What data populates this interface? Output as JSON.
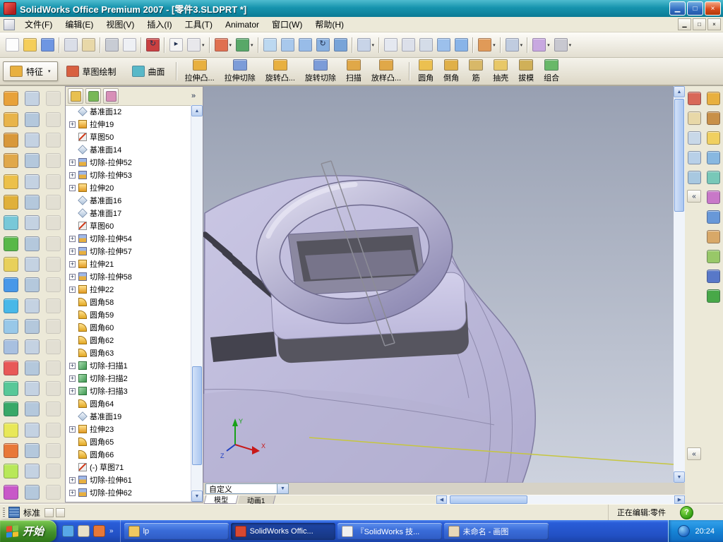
{
  "window": {
    "title": "SolidWorks Office Premium 2007 - [零件3.SLDPRT *]"
  },
  "icons": {
    "dropdown": "▾",
    "chevron_double_left": "«",
    "chevron_double_right": "»",
    "up": "▲",
    "down": "▼",
    "left": "◀",
    "right": "▶",
    "minimize": "▁",
    "maximize": "□",
    "close": "×",
    "plus": "+"
  },
  "menu": {
    "items": [
      {
        "label": "文件(F)",
        "name": "menu-file"
      },
      {
        "label": "编辑(E)",
        "name": "menu-edit"
      },
      {
        "label": "视图(V)",
        "name": "menu-view"
      },
      {
        "label": "插入(I)",
        "name": "menu-insert"
      },
      {
        "label": "工具(T)",
        "name": "menu-tools"
      },
      {
        "label": "Animator",
        "name": "menu-animator"
      },
      {
        "label": "窗口(W)",
        "name": "menu-window"
      },
      {
        "label": "帮助(H)",
        "name": "menu-help"
      }
    ]
  },
  "main_toolbar": {
    "buttons": [
      {
        "name": "new-button",
        "color": "#FDFDFD"
      },
      {
        "name": "open-button",
        "color": "#F5CE5A"
      },
      {
        "name": "save-button",
        "color": "#6E96E2"
      },
      {
        "sep": true
      },
      {
        "name": "make-drawing-button",
        "color": "#DADEE8"
      },
      {
        "name": "make-assembly-button",
        "color": "#E8D8A8"
      },
      {
        "sep": true
      },
      {
        "name": "print-button",
        "color": "#C8CCD4"
      },
      {
        "name": "print-preview-button",
        "color": "#EEF0F4"
      },
      {
        "sep": true
      },
      {
        "name": "rebuild-button",
        "color": "#C94040",
        "glyph": "↻"
      },
      {
        "sep": true
      },
      {
        "name": "select-button",
        "color": "#F4F4F4",
        "glyph": "▸"
      },
      {
        "name": "selection-filter-button",
        "color": "#E8E8EC",
        "dd": true
      },
      {
        "sep": true
      },
      {
        "name": "sketch-button",
        "color": "#E07050",
        "dd": true
      },
      {
        "name": "smart-dimension-button",
        "color": "#58A868",
        "dd": true
      },
      {
        "sep": true
      },
      {
        "name": "zoom-fit-button",
        "color": "#BCD8F0"
      },
      {
        "name": "zoom-area-button",
        "color": "#A8C8EC"
      },
      {
        "name": "zoom-in-out-button",
        "color": "#98BCE8"
      },
      {
        "name": "rotate-view-button",
        "color": "#88B0E0",
        "glyph": "↻"
      },
      {
        "name": "pan-button",
        "color": "#78A4D8"
      },
      {
        "sep": true
      },
      {
        "name": "standard-views-button",
        "color": "#C8D4E8",
        "dd": true
      },
      {
        "sep": true
      },
      {
        "name": "wireframe-button",
        "color": "#E4E8F0"
      },
      {
        "name": "hidden-lines-visible-button",
        "color": "#DCE0EA"
      },
      {
        "name": "hidden-lines-removed-button",
        "color": "#D4DCE8"
      },
      {
        "name": "shaded-with-edges-button",
        "color": "#9CC0EC"
      },
      {
        "name": "shaded-button",
        "color": "#88B4E8"
      },
      {
        "sep": true
      },
      {
        "name": "section-view-button",
        "color": "#E09A58",
        "dd": true
      },
      {
        "sep": true
      },
      {
        "name": "view-orientation-button",
        "color": "#C0CCE0",
        "dd": true
      },
      {
        "sep": true
      },
      {
        "name": "appearance-button",
        "color": "#C8A8E0",
        "dd": true
      },
      {
        "name": "options-button",
        "color": "#C8C8D0",
        "dd": true
      }
    ]
  },
  "feature_bar": {
    "tabs": [
      {
        "label": "特征",
        "name": "tab-features",
        "color": "#E8B040",
        "active": true,
        "dd": true
      },
      {
        "label": "草图绘制",
        "name": "tab-sketch",
        "color": "#D86040"
      },
      {
        "label": "曲面",
        "name": "tab-surfaces",
        "color": "#58B8C8"
      }
    ],
    "buttons": [
      {
        "label": "拉伸凸...",
        "name": "extruded-boss-button",
        "color": "#E8B040"
      },
      {
        "label": "拉伸切除",
        "name": "extruded-cut-button",
        "color": "#7C9CD8"
      },
      {
        "label": "旋转凸...",
        "name": "revolved-boss-button",
        "color": "#E8B040"
      },
      {
        "label": "旋转切除",
        "name": "revolved-cut-button",
        "color": "#7C9CD8"
      },
      {
        "label": "扫描",
        "name": "swept-boss-button",
        "color": "#E0A848"
      },
      {
        "label": "放样凸...",
        "name": "lofted-boss-button",
        "color": "#E0A848"
      },
      {
        "sep": true
      },
      {
        "label": "圆角",
        "name": "fillet-button",
        "color": "#ECC050"
      },
      {
        "label": "倒角",
        "name": "chamfer-button",
        "color": "#E0B048"
      },
      {
        "label": "筋",
        "name": "rib-button",
        "color": "#D8B868"
      },
      {
        "label": "抽壳",
        "name": "shell-button",
        "color": "#E8C868"
      },
      {
        "label": "拔模",
        "name": "draft-button",
        "color": "#D0B058"
      },
      {
        "label": "组合",
        "name": "combine-button",
        "color": "#68B868"
      }
    ]
  },
  "left_toolbox": {
    "col_a": [
      {
        "name": "extruded-surface-button",
        "color": "#E8A23A"
      },
      {
        "name": "revolved-surface-button",
        "color": "#E8B44A"
      },
      {
        "name": "swept-surface-button",
        "color": "#D8983A"
      },
      {
        "name": "lofted-surface-button",
        "color": "#E0A84A"
      },
      {
        "name": "boundary-surface-button",
        "color": "#ECC04A"
      },
      {
        "name": "planar-surface-button",
        "color": "#E0B03A"
      },
      {
        "name": "offset-surface-button",
        "color": "#78C8D8"
      },
      {
        "name": "ruled-surface-button",
        "color": "#58B848"
      },
      {
        "name": "filled-surface-button",
        "color": "#E8D05A"
      },
      {
        "name": "knit-surface-button",
        "color": "#4898E8"
      },
      {
        "name": "trim-surface-button",
        "color": "#48B8E8"
      },
      {
        "name": "extend-surface-button",
        "color": "#98C8E8"
      },
      {
        "name": "delete-face-button",
        "color": "#A8C0E0"
      },
      {
        "name": "replace-face-button",
        "color": "#E85858"
      },
      {
        "name": "thicken-button",
        "color": "#58C898"
      },
      {
        "name": "fillet-surface-button",
        "color": "#38A868"
      },
      {
        "name": "mirror-feature-button",
        "color": "#E8E858"
      },
      {
        "name": "linear-pattern-button",
        "color": "#E87838"
      },
      {
        "name": "circular-pattern-button",
        "color": "#B8E858"
      },
      {
        "name": "reference-geometry-button",
        "color": "#C858C8"
      }
    ],
    "col_b": [
      {
        "name": "select-tool-button",
        "color": "#C4D2E2"
      },
      {
        "name": "line-tool-button",
        "color": "#B4C8DC"
      },
      {
        "name": "rectangle-tool-button",
        "color": "#C4D2E2"
      },
      {
        "name": "circle-tool-button",
        "color": "#B4C8DC"
      },
      {
        "name": "arc-tool-button",
        "color": "#C4D2E2"
      },
      {
        "name": "ellipse-tool-button",
        "color": "#B4C8DC"
      },
      {
        "name": "spline-tool-button",
        "color": "#C4D2E2"
      },
      {
        "name": "point-tool-button",
        "color": "#B4C8DC"
      },
      {
        "name": "centerline-tool-button",
        "color": "#C4D2E2"
      },
      {
        "name": "text-tool-button",
        "color": "#B4C8DC"
      },
      {
        "name": "trim-tool-button",
        "color": "#C4D2E2"
      },
      {
        "name": "extend-tool-button",
        "color": "#B4C8DC"
      },
      {
        "name": "offset-entities-button",
        "color": "#C4D2E2"
      },
      {
        "name": "convert-entities-button",
        "color": "#B4C8DC"
      },
      {
        "name": "mirror-entities-button",
        "color": "#C4D2E2"
      },
      {
        "name": "sketch-pattern-button",
        "color": "#B4C8DC"
      },
      {
        "name": "smart-dimension-tool-button",
        "color": "#C4D2E2"
      },
      {
        "name": "add-relation-button",
        "color": "#B4C8DC"
      },
      {
        "name": "quick-snaps-button",
        "color": "#C4D2E2"
      },
      {
        "name": "grid-settings-button",
        "color": "#B4C8DC"
      }
    ],
    "col_c": [
      {
        "name": "base-flange-button",
        "color": "#D6D2C6",
        "disabled": true
      },
      {
        "name": "edge-flange-button",
        "color": "#D6D2C6",
        "disabled": true
      },
      {
        "name": "miter-flange-button",
        "color": "#D6D2C6",
        "disabled": true
      },
      {
        "name": "hem-button",
        "color": "#D6D2C6",
        "disabled": true
      },
      {
        "name": "jog-button",
        "color": "#D6D2C6",
        "disabled": true
      },
      {
        "name": "sketched-bend-button",
        "color": "#D6D2C6",
        "disabled": true
      },
      {
        "name": "closed-corner-button",
        "color": "#D6D2C6",
        "disabled": true
      },
      {
        "name": "forming-tool-button",
        "color": "#D6D2C6",
        "disabled": true
      },
      {
        "name": "vent-feature-button",
        "color": "#D6D2C6",
        "disabled": true
      },
      {
        "name": "unfold-button",
        "color": "#D6D2C6",
        "disabled": true
      },
      {
        "name": "fold-button",
        "color": "#D6D2C6",
        "disabled": true
      },
      {
        "name": "flatten-button",
        "color": "#D6D2C6",
        "disabled": true
      },
      {
        "name": "rip-button",
        "color": "#D6D2C6",
        "disabled": true
      },
      {
        "name": "lofted-bend-button",
        "color": "#D6D2C6",
        "disabled": true
      },
      {
        "name": "cross-break-button",
        "color": "#D6D2C6",
        "disabled": true
      },
      {
        "name": "break-corner-button",
        "color": "#D6D2C6",
        "disabled": true
      },
      {
        "name": "corner-relief-button",
        "color": "#D6D2C6",
        "disabled": true
      },
      {
        "name": "welded-corner-button",
        "color": "#D6D2C6",
        "disabled": true
      },
      {
        "name": "tab-feature-button",
        "color": "#D6D2C6",
        "disabled": true
      },
      {
        "name": "sheet-metal-options-button",
        "color": "#D6D2C6",
        "disabled": true
      }
    ]
  },
  "tree": {
    "header_buttons": [
      {
        "name": "featuremanager-tree-tab-button",
        "color": "#E8C050"
      },
      {
        "name": "propertymanager-tab-button",
        "color": "#78B858"
      },
      {
        "name": "configurationmanager-tab-button",
        "color": "#D890B8"
      }
    ],
    "items": [
      {
        "label": "基准面12",
        "icon": "plane"
      },
      {
        "label": "拉伸19",
        "icon": "extrude",
        "expand": true
      },
      {
        "label": "草图50",
        "icon": "sketch"
      },
      {
        "label": "基准面14",
        "icon": "plane"
      },
      {
        "label": "切除-拉伸52",
        "icon": "cut",
        "expand": true
      },
      {
        "label": "切除-拉伸53",
        "icon": "cut",
        "expand": true
      },
      {
        "label": "拉伸20",
        "icon": "extrude",
        "expand": true
      },
      {
        "label": "基准面16",
        "icon": "plane"
      },
      {
        "label": "基准面17",
        "icon": "plane"
      },
      {
        "label": "草图60",
        "icon": "sketch"
      },
      {
        "label": "切除-拉伸54",
        "icon": "cut",
        "expand": true
      },
      {
        "label": "切除-拉伸57",
        "icon": "cut",
        "expand": true
      },
      {
        "label": "拉伸21",
        "icon": "extrude",
        "expand": true
      },
      {
        "label": "切除-拉伸58",
        "icon": "cut",
        "expand": true
      },
      {
        "label": "拉伸22",
        "icon": "extrude",
        "expand": true
      },
      {
        "label": "圆角58",
        "icon": "fillet"
      },
      {
        "label": "圆角59",
        "icon": "fillet"
      },
      {
        "label": "圆角60",
        "icon": "fillet"
      },
      {
        "label": "圆角62",
        "icon": "fillet"
      },
      {
        "label": "圆角63",
        "icon": "fillet"
      },
      {
        "label": "切除-扫描1",
        "icon": "sweepcut",
        "expand": true
      },
      {
        "label": "切除-扫描2",
        "icon": "sweepcut",
        "expand": true
      },
      {
        "label": "切除-扫描3",
        "icon": "sweepcut",
        "expand": true
      },
      {
        "label": "圆角64",
        "icon": "fillet"
      },
      {
        "label": "基准面19",
        "icon": "plane"
      },
      {
        "label": "拉伸23",
        "icon": "extrude",
        "expand": true
      },
      {
        "label": "圆角65",
        "icon": "fillet"
      },
      {
        "label": "圆角66",
        "icon": "fillet"
      },
      {
        "label": "(-) 草图71",
        "icon": "sketch"
      },
      {
        "label": "切除-拉伸61",
        "icon": "cut",
        "expand": true
      },
      {
        "label": "切除-拉伸62",
        "icon": "cut",
        "expand": true
      }
    ]
  },
  "viewport": {
    "combo_value": "自定义",
    "triad": {
      "x": "X",
      "y": "Y",
      "z": "Z"
    },
    "tabs": [
      {
        "label": "模型",
        "name": "tab-model",
        "active": true
      },
      {
        "label": "动画1",
        "name": "tab-motion1"
      }
    ]
  },
  "right_pane": {
    "view_buttons": [
      {
        "name": "fullscreen-button",
        "color": "#D86858"
      },
      {
        "name": "home-view-button",
        "color": "#E8D8A8"
      },
      {
        "name": "multi-sheet-button",
        "color": "#C8D8E8"
      },
      {
        "name": "magnifier-button",
        "color": "#B8D0E8"
      },
      {
        "name": "layers-button",
        "color": "#A8C8E0"
      }
    ],
    "task_pane_buttons": [
      {
        "name": "resources-tab-button",
        "color": "#E8B040"
      },
      {
        "name": "design-library-tab-button",
        "color": "#C89048"
      },
      {
        "name": "file-explorer-tab-button",
        "color": "#F0D060"
      },
      {
        "name": "search-tab-button",
        "color": "#88B8E0"
      },
      {
        "name": "view-palette-tab-button",
        "color": "#78C8B8"
      },
      {
        "name": "appearances-tab-button",
        "color": "#C878C8"
      },
      {
        "name": "scenes-tab-button",
        "color": "#6898D8"
      },
      {
        "name": "decals-tab-button",
        "color": "#D8A868"
      },
      {
        "name": "document-recovery-tab-button",
        "color": "#98C868"
      },
      {
        "name": "forum-tab-button",
        "color": "#5878C8"
      },
      {
        "name": "help-tab-button",
        "color": "#48A848"
      }
    ]
  },
  "statusbar": {
    "toolbar_label": "标准",
    "editing": "正在编辑:零件",
    "help": "?"
  },
  "taskbar": {
    "start": "开始",
    "quick_launch": [
      {
        "name": "internet-explorer-icon",
        "color": "#58A8E8"
      },
      {
        "name": "show-desktop-icon",
        "color": "#E8E0C8"
      },
      {
        "name": "media-player-icon",
        "color": "#E87838"
      }
    ],
    "tasks": [
      {
        "label": "lp",
        "name": "task-lp",
        "color": "#F0C860"
      },
      {
        "label": "SolidWorks Offic...",
        "name": "task-solidworks",
        "color": "#D84830",
        "active": true
      },
      {
        "label": "『SolidWorks 技...",
        "name": "task-solidworks-doc",
        "color": "#F0F0F0"
      },
      {
        "label": "未命名 - 画图",
        "name": "task-paint",
        "color": "#E8D8B8"
      }
    ],
    "tray": {
      "time": "20:24"
    }
  }
}
